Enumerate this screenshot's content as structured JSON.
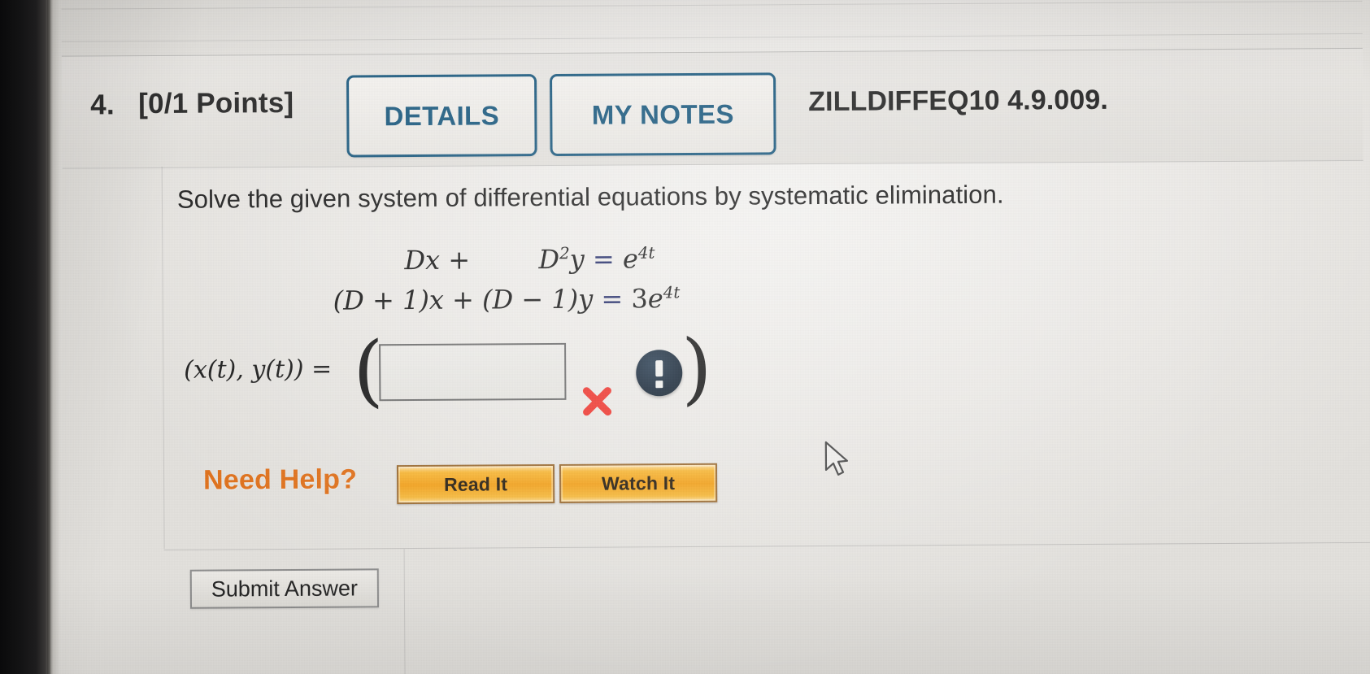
{
  "header": {
    "question_number": "4.",
    "points": "[0/1 Points]",
    "details_label": "DETAILS",
    "my_notes_label": "MY NOTES",
    "question_code": "ZILLDIFFEQ10 4.9.009."
  },
  "problem": {
    "prompt": "Solve the given system of differential equations by systematic elimination.",
    "equation_1": {
      "lhs_term_1": "Dx",
      "plus": "+",
      "lhs_term_2_base": "D",
      "lhs_term_2_exponent": "2",
      "lhs_term_2_var": "y",
      "equals": "=",
      "rhs_base": "e",
      "rhs_exponent": "4t"
    },
    "equation_2": {
      "lhs_term_1": "(D + 1)x",
      "plus": "+",
      "lhs_term_2": "(D − 1)y",
      "equals": "=",
      "rhs_coefficient": "3",
      "rhs_base": "e",
      "rhs_exponent": "4t"
    },
    "equation_1_plain": "Dx + D^2 y = e^(4t)",
    "equation_2_plain": "(D + 1)x + (D − 1)y = 3e^(4t)"
  },
  "answer": {
    "label": "(x(t), y(t)) =",
    "open_paren": "(",
    "close_paren": ")",
    "input_value": "",
    "input_placeholder": "",
    "incorrect_mark": "x-mark-icon",
    "alert_icon": "exclamation-circle-icon"
  },
  "help": {
    "title": "Need Help?",
    "read_it_label": "Read It",
    "watch_it_label": "Watch It"
  },
  "footer": {
    "submit_label": "Submit Answer"
  },
  "colors": {
    "button_blue": "#1d5b80",
    "help_orange": "#e0701a",
    "help_button_gold": "#f2a11c",
    "incorrect_red": "#ef3b34",
    "alert_navy": "#1c2c3c",
    "page_background": "#ebe9e6"
  }
}
